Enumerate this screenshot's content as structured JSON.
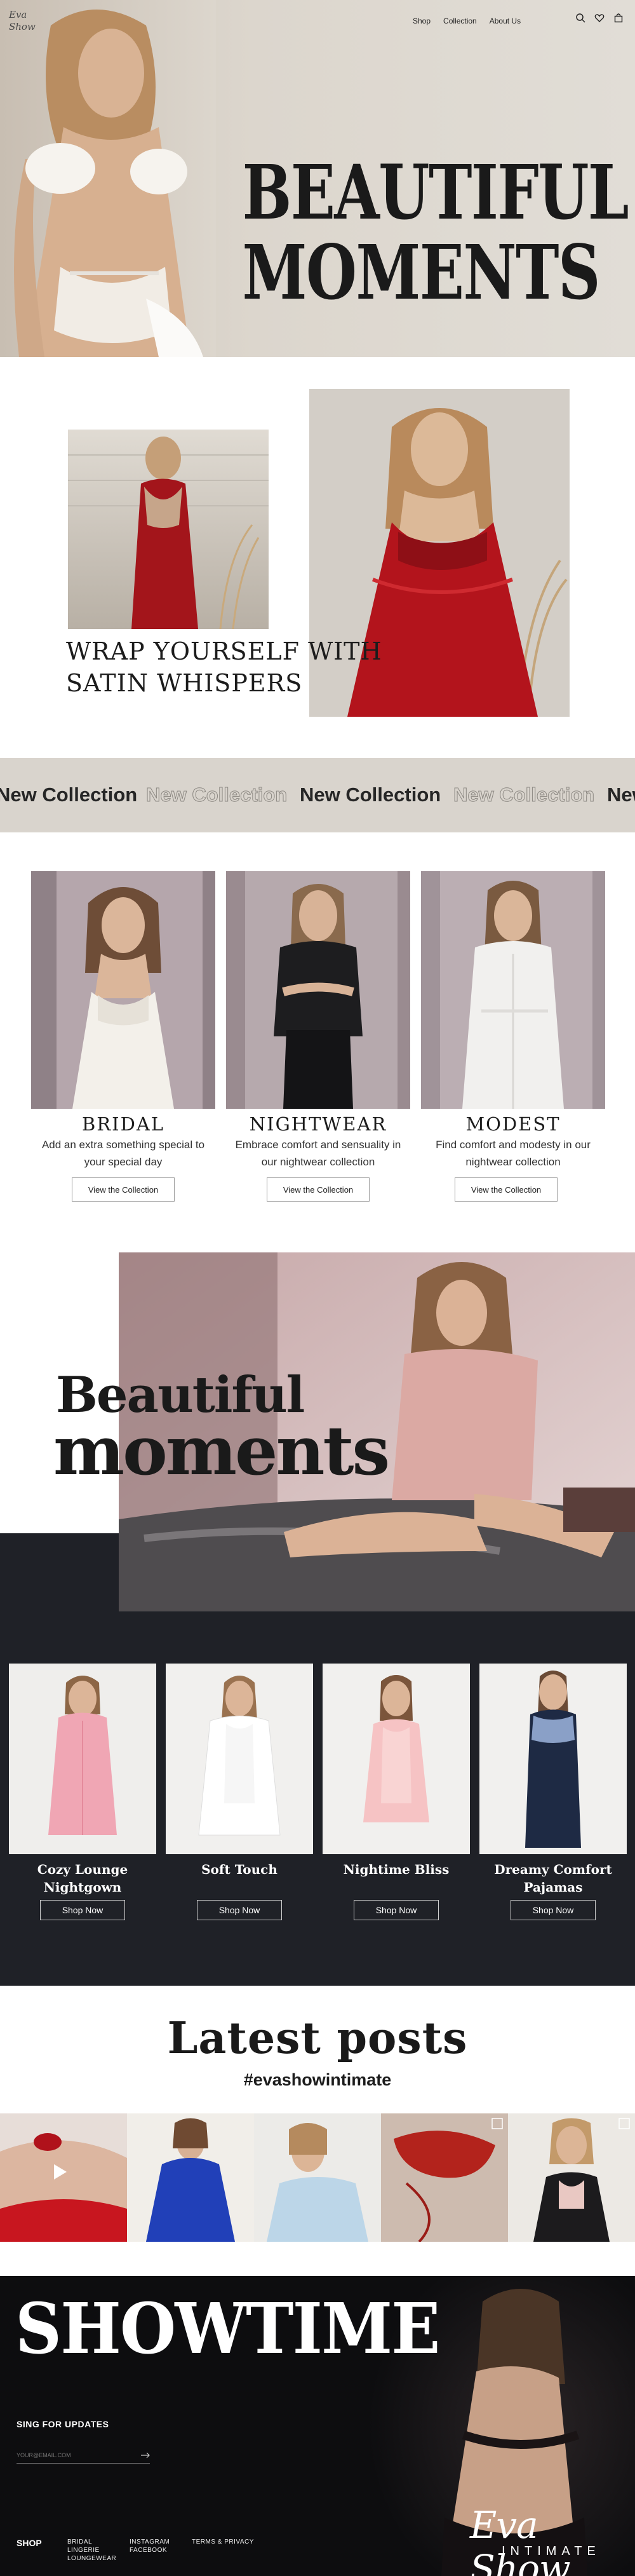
{
  "header": {
    "logo_text": "Eva Show",
    "nav": [
      {
        "label": "Shop"
      },
      {
        "label": "Collection"
      },
      {
        "label": "About Us"
      }
    ],
    "icons": [
      "search-icon",
      "heart-icon",
      "bag-icon"
    ]
  },
  "hero": {
    "title_line1": "BEAUTIFUL",
    "title_line2": "MOMENTS"
  },
  "satin": {
    "title_line1": "WRAP YOURSELF WITH",
    "title_line2": "SATIN WHISPERS"
  },
  "marquee": {
    "text": "New Collection"
  },
  "categories": [
    {
      "title": "BRIDAL",
      "description": "Add an extra something special to your special day",
      "button": "View the Collection"
    },
    {
      "title": "NIGHTWEAR",
      "description": "Embrace comfort and sensuality in our nightwear collection",
      "button": "View the Collection"
    },
    {
      "title": "MODEST",
      "description": "Find comfort and modesty in our nightwear collection",
      "button": "View the Collection"
    }
  ],
  "feature": {
    "line1": "Beautiful",
    "line2": "moments"
  },
  "products": [
    {
      "name": "Cozy Lounge Nightgown",
      "button": "Shop Now"
    },
    {
      "name": "Soft Touch",
      "button": "Shop Now"
    },
    {
      "name": "Nightime Bliss",
      "button": "Shop Now"
    },
    {
      "name": "Dreamy Comfort Pajamas",
      "button": "Shop Now"
    }
  ],
  "posts": {
    "title": "Latest posts",
    "hashtag": "#evashowintimate"
  },
  "footer": {
    "big_title": "SHOWTIME",
    "signup_title": "SING FOR UPDATES",
    "email_placeholder": "YOUR@EMAIL.COM",
    "shop_label": "SHOP",
    "col1": [
      "BRIDAL",
      "LINGERIE",
      "LOUNGEWEAR"
    ],
    "col2": [
      "INSTAGRAM",
      "FACEBOOK"
    ],
    "col3": [
      "TERMS & PRIVACY"
    ],
    "brand_script": "Eva Show",
    "brand_sub": "INTIMATE"
  },
  "colors": {
    "dark_bg": "#1f2127",
    "footer_bg": "#0d0d0f",
    "marquee_bg": "#d9d4cd",
    "hero_bg": "#dcd6cd"
  }
}
